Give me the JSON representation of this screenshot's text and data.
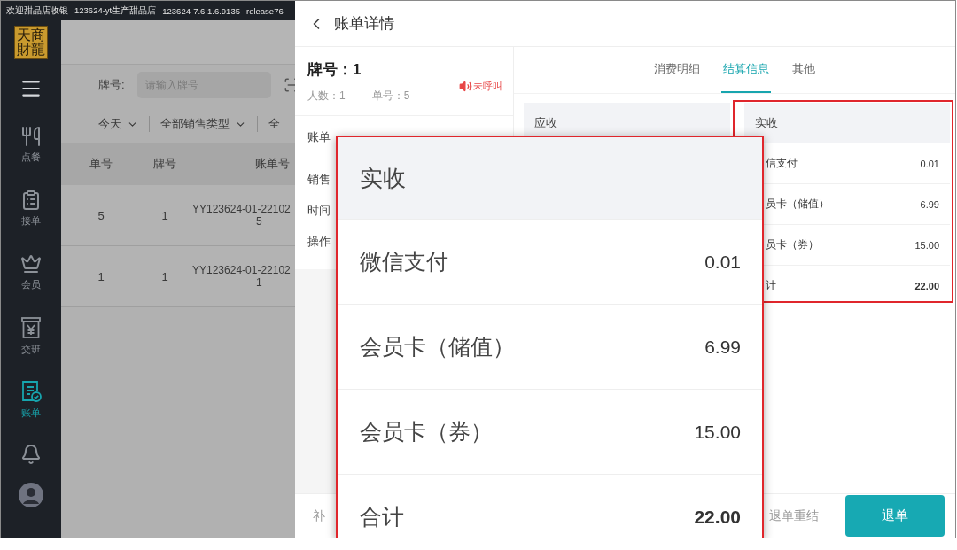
{
  "status_bar": [
    "欢迎甜品店收银",
    "123624-yt生产甜品店",
    "123624-7.6.1.6.9135",
    "release76"
  ],
  "logo": "天商財龍",
  "sidebar": {
    "items": [
      {
        "kind": "dining",
        "label": "点餐",
        "selected": false
      },
      {
        "kind": "orders",
        "label": "接单",
        "selected": false
      },
      {
        "kind": "member",
        "label": "会员",
        "selected": false
      },
      {
        "kind": "shift",
        "label": "交班",
        "selected": false
      },
      {
        "kind": "bills",
        "label": "账单",
        "selected": true
      }
    ]
  },
  "filter": {
    "label": "牌号:",
    "placeholder": "请输入牌号"
  },
  "dropdowns": [
    {
      "label": "今天",
      "caret": true
    },
    {
      "label": "全部销售类型",
      "caret": true
    },
    {
      "label": "全",
      "caret": false
    }
  ],
  "table": {
    "columns": [
      "单号",
      "牌号",
      "账单号"
    ],
    "rows": [
      [
        "5",
        "1",
        [
          "YY123624-01-22102",
          "5"
        ]
      ],
      [
        "1",
        "1",
        [
          "YY123624-01-22102",
          "1"
        ]
      ]
    ]
  },
  "drawer": {
    "title": "账单详情",
    "plate": "牌号：1",
    "people": "人数：1",
    "order_no": "单号：5",
    "call_status": "未呼叫",
    "info_labels": [
      "账单",
      "销售",
      "时间",
      "操作"
    ],
    "footer_left": "补",
    "actions": [
      {
        "label": "退单重结",
        "kind": "text"
      },
      {
        "label": "退单",
        "kind": "primary"
      }
    ],
    "tabs": [
      {
        "label": "消费明细",
        "selected": false
      },
      {
        "label": "结算信息",
        "selected": true
      },
      {
        "label": "其他",
        "selected": false
      }
    ],
    "receivable": {
      "title": "应收"
    },
    "received": {
      "title": "实收",
      "rows": [
        {
          "label": "信支付",
          "value": "0.01",
          "kind": "item"
        },
        {
          "label": "员卡（储值）",
          "value": "6.99",
          "kind": "item"
        },
        {
          "label": "员卡（券）",
          "value": "15.00",
          "kind": "item"
        },
        {
          "label": "计",
          "value": "22.00",
          "kind": "total"
        }
      ]
    }
  },
  "callout": {
    "title": "实收",
    "rows": [
      {
        "label": "微信支付",
        "value": "0.01",
        "kind": "item"
      },
      {
        "label": "会员卡（储值）",
        "value": "6.99",
        "kind": "item"
      },
      {
        "label": "会员卡（券）",
        "value": "15.00",
        "kind": "item"
      },
      {
        "label": "合计",
        "value": "22.00",
        "kind": "total"
      }
    ]
  }
}
